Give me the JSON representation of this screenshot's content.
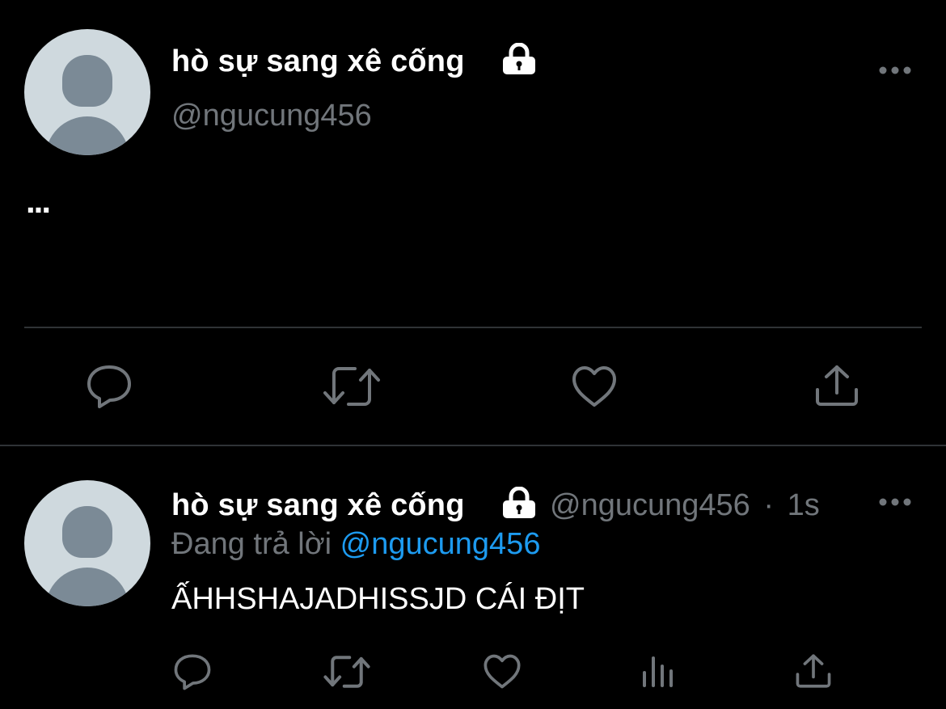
{
  "colors": {
    "background": "#000000",
    "text": "#ffffff",
    "secondary": "#71767b",
    "accent": "#1d9bf0",
    "divider": "#2f3336"
  },
  "main_tweet": {
    "display_name": "hò sự sang xê cống",
    "handle": "@ngucung456",
    "body": "...",
    "icons": {
      "lock": "lock-icon",
      "more": "more-icon",
      "reply": "reply-icon",
      "retweet": "retweet-icon",
      "like": "like-icon",
      "share": "share-icon"
    }
  },
  "reply_tweet": {
    "display_name": "hò sự sang xê cống",
    "handle": "@ngucung456",
    "separator": "·",
    "time": "1s",
    "replying_prefix": "Đang trả lời",
    "replying_to": "@ngucung456",
    "body": "ẤHHSHAJADHISSJD CÁI ĐỊT",
    "icons": {
      "lock": "lock-icon",
      "more": "more-icon",
      "reply": "reply-icon",
      "retweet": "retweet-icon",
      "like": "like-icon",
      "views": "views-icon",
      "share": "share-icon"
    }
  }
}
